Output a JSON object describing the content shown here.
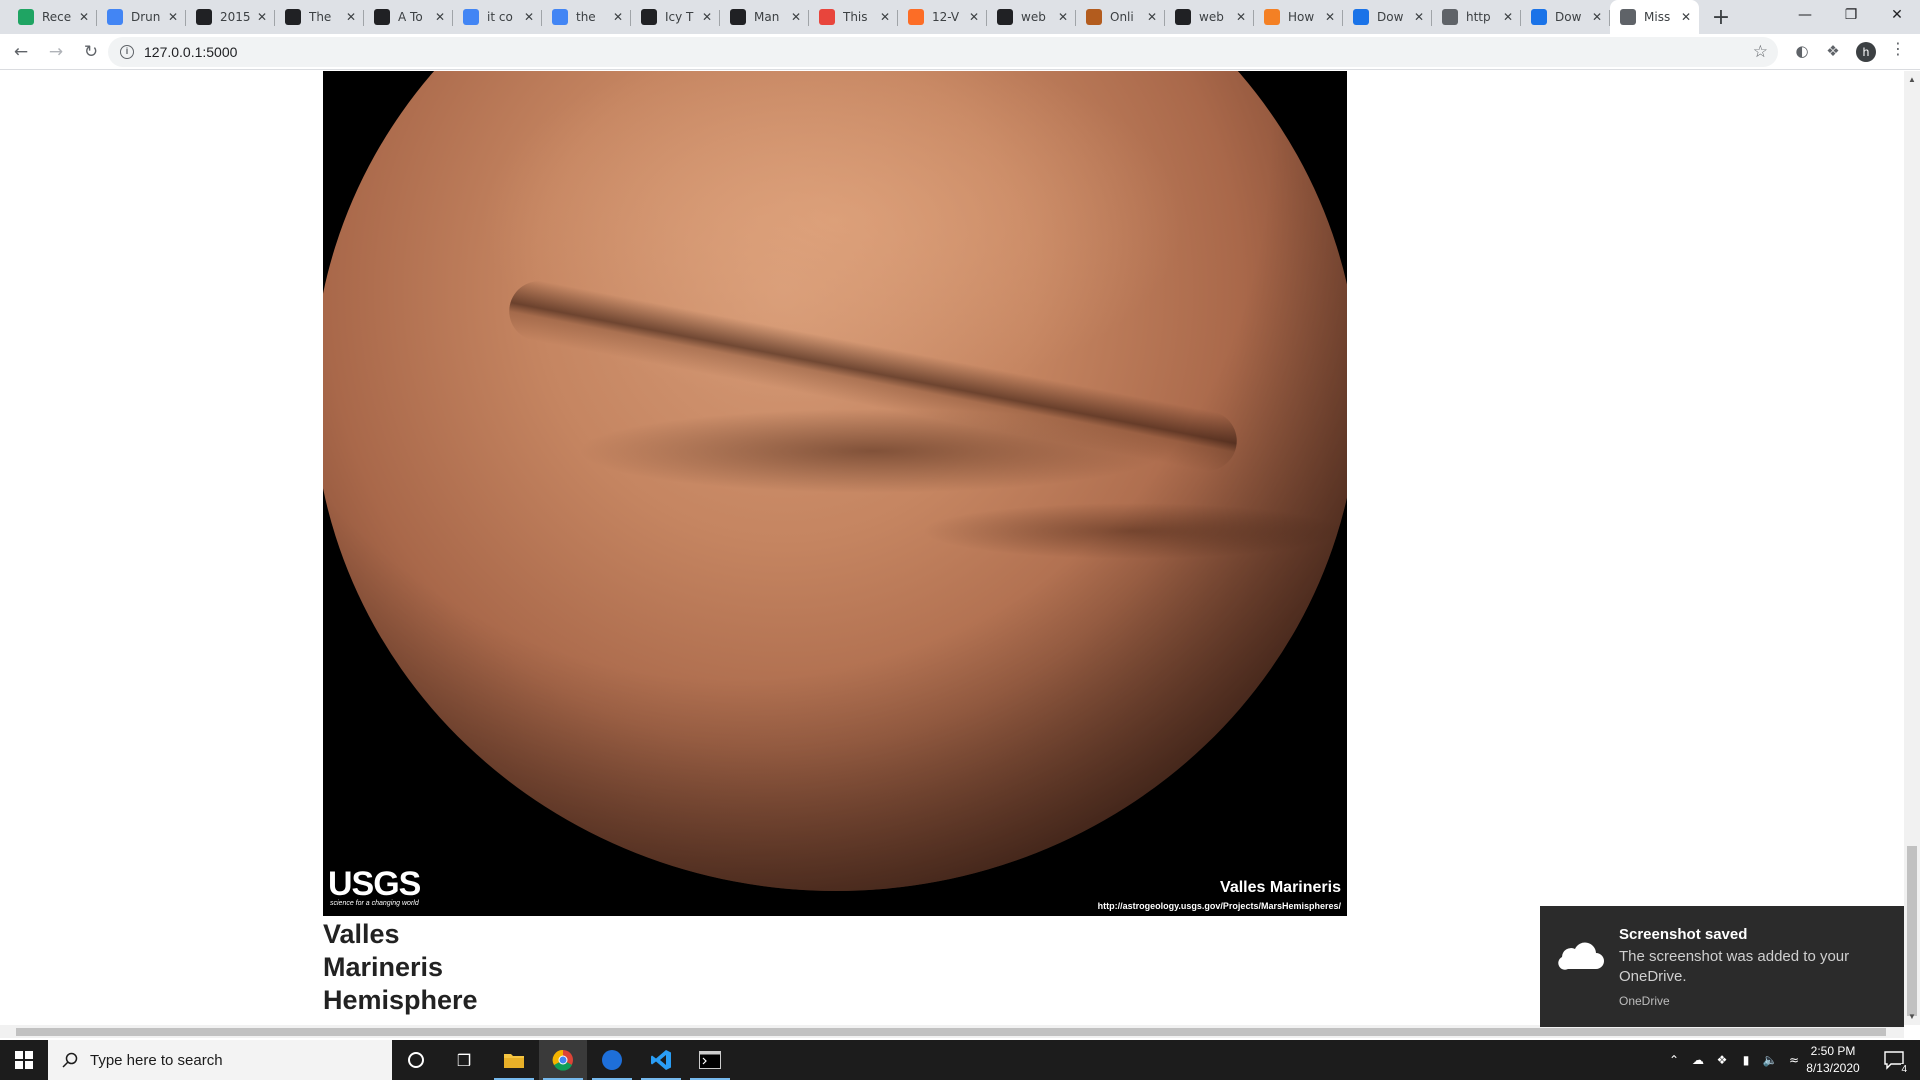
{
  "browser": {
    "tabs": [
      {
        "title": "Rece",
        "favicon": "google-drive-icon",
        "color": "#1fa463"
      },
      {
        "title": "Drun",
        "favicon": "google-docs-icon",
        "color": "#4285f4"
      },
      {
        "title": "2015",
        "favicon": "building-icon",
        "color": "#202124"
      },
      {
        "title": "The",
        "favicon": "d-letter-icon",
        "color": "#202124"
      },
      {
        "title": "A To",
        "favicon": "a-letter-icon",
        "color": "#202124"
      },
      {
        "title": "it co",
        "favicon": "google-icon",
        "color": "#4285f4"
      },
      {
        "title": "the",
        "favicon": "google-icon",
        "color": "#4285f4"
      },
      {
        "title": "Icy T",
        "favicon": "circle-icon",
        "color": "#202124"
      },
      {
        "title": "Man",
        "favicon": "c-letter-icon",
        "color": "#202124"
      },
      {
        "title": "This",
        "favicon": "quote-icon",
        "color": "#e8453c"
      },
      {
        "title": "12-V",
        "favicon": "gitlab-icon",
        "color": "#fc6d26"
      },
      {
        "title": "web",
        "favicon": "github-icon",
        "color": "#202124"
      },
      {
        "title": "Onli",
        "favicon": "bird-icon",
        "color": "#b35c1e"
      },
      {
        "title": "web",
        "favicon": "github-icon",
        "color": "#202124"
      },
      {
        "title": "How",
        "favicon": "flame-icon",
        "color": "#f48024"
      },
      {
        "title": "Dow",
        "favicon": "window-icon",
        "color": "#1a73e8"
      },
      {
        "title": "http",
        "favicon": "globe-icon",
        "color": "#5f6368"
      },
      {
        "title": "Dow",
        "favicon": "window-icon",
        "color": "#1a73e8"
      },
      {
        "title": "Miss",
        "favicon": "globe-icon",
        "color": "#5f6368",
        "active": true
      }
    ],
    "url": "127.0.0.1:5000",
    "profile_initial": "h"
  },
  "page": {
    "image_caption_title": "Valles Marineris",
    "image_caption_url": "http://astrogeology.usgs.gov/Projects/MarsHemispheres/",
    "logo_text": "USGS",
    "logo_tagline": "science for a changing world",
    "hemisphere_title_lines": [
      "Valles",
      "Marineris",
      "Hemisphere"
    ]
  },
  "toast": {
    "title": "Screenshot saved",
    "body": "The screenshot was added to your OneDrive.",
    "source": "OneDrive"
  },
  "taskbar": {
    "search_placeholder": "Type here to search",
    "time": "2:50 PM",
    "date": "8/13/2020",
    "notification_count": "4"
  },
  "colors": {
    "taskbar_bg": "#1c1c1c",
    "toast_bg": "#2b2b2b",
    "tabstrip_bg": "#dee1e6"
  }
}
